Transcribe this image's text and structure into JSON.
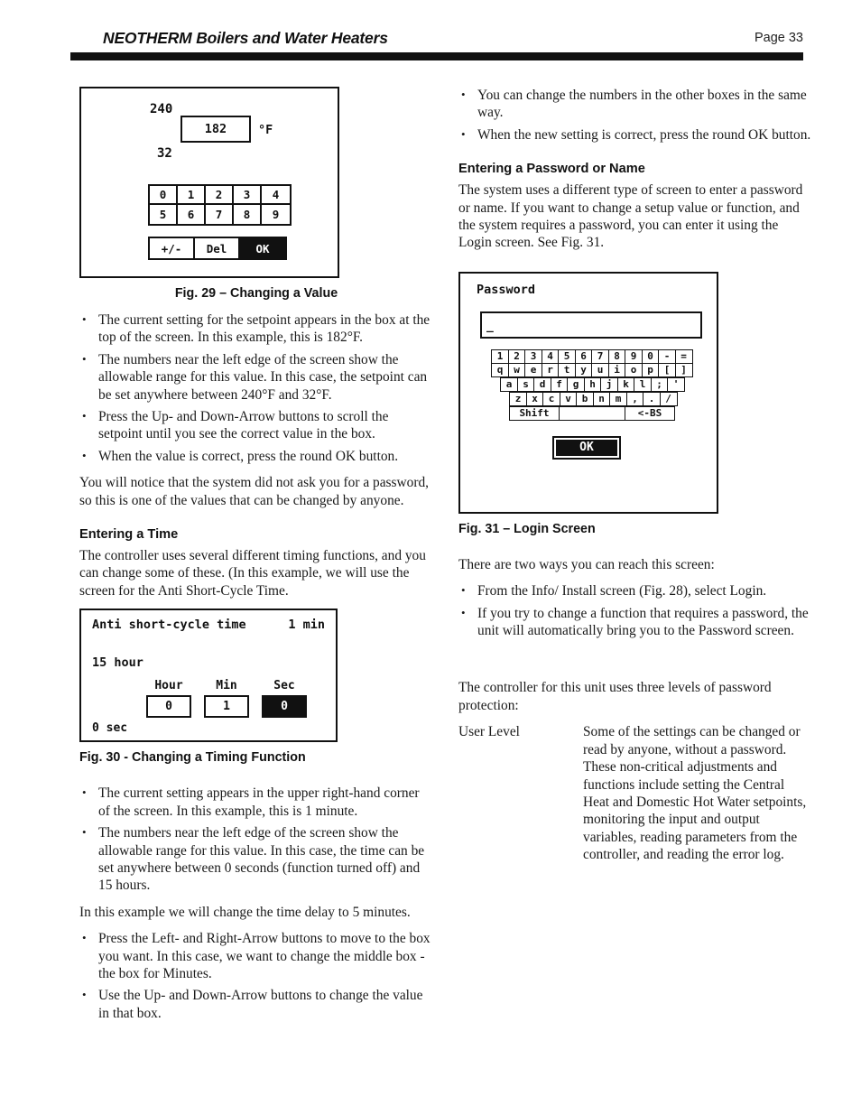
{
  "header": {
    "title": "NEOTHERM Boilers and Water Heaters",
    "page_number": "Page 33"
  },
  "figures": {
    "fig29": {
      "caption": "Fig. 29 – Changing a Value",
      "range_high": "240",
      "range_low": "32",
      "value": "182",
      "unit": "°F",
      "keypad_row1": [
        "0",
        "1",
        "2",
        "3",
        "4"
      ],
      "keypad_row2": [
        "5",
        "6",
        "7",
        "8",
        "9"
      ],
      "actions": [
        {
          "label": "+/-",
          "selected": false
        },
        {
          "label": "Del",
          "selected": false
        },
        {
          "label": "OK",
          "selected": true
        }
      ]
    },
    "fig30": {
      "caption": "Fig. 30 - Changing a Timing Function",
      "title": "Anti short-cycle time",
      "current_value": "1 min",
      "range_high": "15 hour",
      "range_low": "0 sec",
      "fields": [
        {
          "label": "Hour",
          "value": "0",
          "selected": false
        },
        {
          "label": "Min",
          "value": "1",
          "selected": false
        },
        {
          "label": "Sec",
          "value": "0",
          "selected": true
        }
      ]
    },
    "fig31": {
      "caption": "Fig. 31 – Login Screen",
      "field_label": "Password",
      "field_value": "_",
      "keyboard": {
        "number_row": [
          "1",
          "2",
          "3",
          "4",
          "5",
          "6",
          "7",
          "8",
          "9",
          "0",
          "-",
          "="
        ],
        "top_row": [
          "q",
          "w",
          "e",
          "r",
          "t",
          "y",
          "u",
          "i",
          "o",
          "p",
          "[",
          "]"
        ],
        "home_row": [
          "a",
          "s",
          "d",
          "f",
          "g",
          "h",
          "j",
          "k",
          "l",
          ";",
          "'"
        ],
        "bottom_row": [
          "z",
          "x",
          "c",
          "v",
          "b",
          "n",
          "m",
          ",",
          ".",
          "/"
        ],
        "shift_key": "Shift",
        "space_key": "",
        "backspace_key": "<-BS"
      },
      "ok_button": "OK"
    }
  },
  "left_column": {
    "fig29_bullets": [
      "The current setting for the setpoint appears in the box at the top of the screen.  In this example, this is 182°F.",
      " The numbers near the left edge of the screen show the allowable range for this value.  In this case, the setpoint can be set anywhere between 240°F and 32°F.",
      "Press the Up- and Down-Arrow buttons to scroll the setpoint until you see the correct value in the box.",
      "When the value is correct, press the round OK button."
    ],
    "password_note": "You will notice that the system did not ask you for a password, so this is one of the values that can be changed by anyone.",
    "entering_time_heading": "Entering a Time",
    "entering_time_intro": "The controller uses several different timing functions, and you can change some of these.   (In this example, we will use the screen for the Anti Short-Cycle Time.",
    "fig30_bullets": [
      "The current setting appears in the upper right-hand corner of the screen.  In this example, this is 1 minute.",
      "The numbers near the left edge of the screen show the allowable range for this value.  In this case, the time can be set anywhere between 0 seconds (function turned off) and 15 hours."
    ],
    "time_delay_note": "In this example we will change the time delay to 5 minutes.",
    "fig30_bullets_2": [
      "Press the Left- and Right-Arrow buttons to move to the box you want.  In this case, we want to change the middle box - the box for Minutes.",
      "Use the Up- and Down-Arrow buttons to change the value in that box."
    ]
  },
  "right_column": {
    "top_bullets": [
      "You can change the numbers in the other boxes in the same way.",
      "When the new setting is correct, press the round OK button."
    ],
    "password_heading": "Entering a Password or Name",
    "password_intro": "The system uses a different type of screen to enter a password or name.  If you want to change a setup value or function, and the system requires a password, you can enter it using the Login screen.  See Fig. 31.",
    "reach_intro": "There are two ways you can reach this screen:",
    "reach_bullets": [
      "From the Info/ Install screen (Fig. 28), select Login.",
      "If you try to change a function that requires a password, the unit will automatically bring you to the Password screen."
    ],
    "levels_intro": "The controller for this unit uses three levels of password protection:",
    "user_level_term": "User Level",
    "user_level_desc": "Some of the settings can be changed or read by anyone, without a password. These non-critical adjustments and functions include setting the Central Heat and Domestic Hot Water setpoints, monitoring the input and output variables, reading parameters from the controller, and reading the error log."
  }
}
